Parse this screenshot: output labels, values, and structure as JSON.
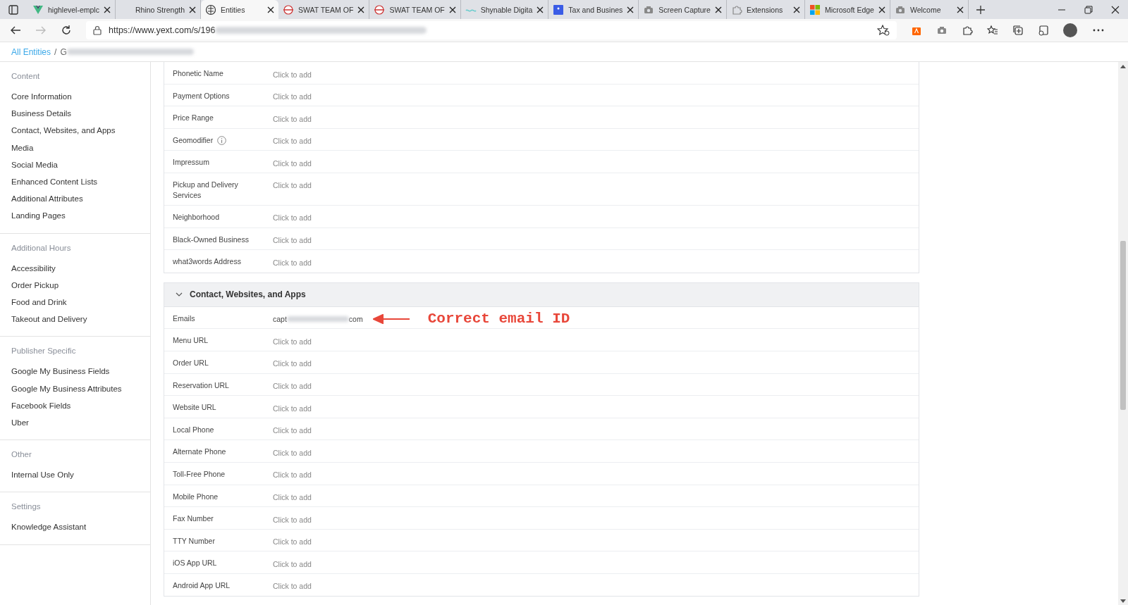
{
  "browser": {
    "tabs": [
      {
        "kind": "vue",
        "label": "highlevel-emplc",
        "selected": false
      },
      {
        "kind": "none",
        "label": "Rhino Strength",
        "selected": false
      },
      {
        "kind": "globe",
        "label": "Entities",
        "selected": true
      },
      {
        "kind": "swat",
        "label": "SWAT TEAM OF",
        "selected": false
      },
      {
        "kind": "swat",
        "label": "SWAT TEAM OF",
        "selected": false
      },
      {
        "kind": "wave",
        "label": "Shynable Digita",
        "selected": false
      },
      {
        "kind": "square",
        "label": "Tax and Busines",
        "selected": false
      },
      {
        "kind": "camera",
        "label": "Screen Capture",
        "selected": false
      },
      {
        "kind": "puzzle",
        "label": "Extensions",
        "selected": false
      },
      {
        "kind": "ms",
        "label": "Microsoft Edge",
        "selected": false
      },
      {
        "kind": "camera",
        "label": "Welcome",
        "selected": false
      }
    ],
    "url": "https://www.yext.com/s/196"
  },
  "breadcrumb": {
    "link": "All Entities",
    "separator": "/",
    "current": "G"
  },
  "sidebar": [
    {
      "heading": "Content",
      "items": [
        "Core Information",
        "Business Details",
        "Contact, Websites, and Apps",
        "Media",
        "Social Media",
        "Enhanced Content Lists",
        "Additional Attributes",
        "Landing Pages"
      ]
    },
    {
      "heading": "Additional Hours",
      "items": [
        "Accessibility",
        "Order Pickup",
        "Food and Drink",
        "Takeout and Delivery"
      ]
    },
    {
      "heading": "Publisher Specific",
      "items": [
        "Google My Business Fields",
        "Google My Business Attributes",
        "Facebook Fields",
        "Uber"
      ]
    },
    {
      "heading": "Other",
      "items": [
        "Internal Use Only"
      ]
    },
    {
      "heading": "Settings",
      "items": [
        "Knowledge Assistant"
      ]
    }
  ],
  "sections": [
    {
      "rows": [
        {
          "label": "Phonetic Name",
          "value": "Click to add",
          "info": false
        },
        {
          "label": "Payment Options",
          "value": "Click to add",
          "info": false
        },
        {
          "label": "Price Range",
          "value": "Click to add",
          "info": false
        },
        {
          "label": "Geomodifier",
          "value": "Click to add",
          "info": true
        },
        {
          "label": "Impressum",
          "value": "Click to add",
          "info": false
        },
        {
          "label": "Pickup and Delivery Services",
          "value": "Click to add",
          "info": false
        },
        {
          "label": "Neighborhood",
          "value": "Click to add",
          "info": false
        },
        {
          "label": "Black-Owned Business",
          "value": "Click to add",
          "info": false
        },
        {
          "label": "what3words Address",
          "value": "Click to add",
          "info": false
        }
      ]
    },
    {
      "title": "Contact, Websites, and Apps",
      "expanded": true,
      "rows": [
        {
          "label": "Emails",
          "value": "capt",
          "value_end": "com",
          "info": false,
          "annotation": "Correct email ID"
        },
        {
          "label": "Menu URL",
          "value": "Click to add",
          "info": false
        },
        {
          "label": "Order URL",
          "value": "Click to add",
          "info": false
        },
        {
          "label": "Reservation URL",
          "value": "Click to add",
          "info": false
        },
        {
          "label": "Website URL",
          "value": "Click to add",
          "info": false
        },
        {
          "label": "Local Phone",
          "value": "Click to add",
          "info": false
        },
        {
          "label": "Alternate Phone",
          "value": "Click to add",
          "info": false
        },
        {
          "label": "Toll-Free Phone",
          "value": "Click to add",
          "info": false
        },
        {
          "label": "Mobile Phone",
          "value": "Click to add",
          "info": false
        },
        {
          "label": "Fax Number",
          "value": "Click to add",
          "info": false
        },
        {
          "label": "TTY Number",
          "value": "Click to add",
          "info": false
        },
        {
          "label": "iOS App URL",
          "value": "Click to add",
          "info": false
        },
        {
          "label": "Android App URL",
          "value": "Click to add",
          "info": false
        }
      ]
    }
  ]
}
